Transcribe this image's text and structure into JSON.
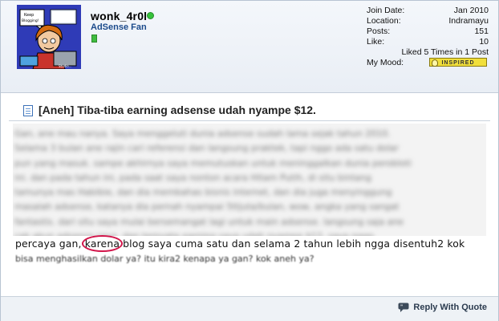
{
  "user": {
    "name": "wonk_4r0l",
    "title": "AdSense Fan",
    "avatar_speech": "Keep Blogging !",
    "avatar_caption": "Studio..."
  },
  "stats": {
    "join_date_label": "Join Date:",
    "join_date": "Jan 2010",
    "location_label": "Location:",
    "location": "Indramayu",
    "posts_label": "Posts:",
    "posts": "151",
    "like_label": "Like:",
    "like": "10",
    "liked_text": "Liked 5 Times in 1 Post",
    "mood_label": "My Mood:",
    "mood": "INSPIRED"
  },
  "post": {
    "title": "[Aneh] Tiba-tiba earning adsense udah nyampe $12.",
    "blurred_lines": [
      "Gan, ane mau nanya. Saya menggeluti dunia adsense sudah lama sejak tahun 2010.",
      "Selama 3 bulan ane rajin cari referensi dan langsung praktek, tapi nggo ada satu dolar",
      "pun yang masuk. sampe akhirnya saya memutuskan untuk meninggalkan dunia perobloti",
      "ini. dan pada tahun ini, pada saat saya nonton acara Hitam Putih, di situ bintang",
      "tamunya mas Habibie, dan dia membahas bisnis internet, dan dia juga menyinggung",
      "masalah adsense, katanya dia pernah nyampai 5ttjuta/bulan, wow, angka yang sangat",
      "fantastis. dari situ saya mulai bersemangat lagi untuk main adsense. langsung saja ane",
      "cek akun adsense saya, dan ternyata earning saya udah nyampe $12, saya nggo"
    ],
    "line_before": "percaya gan,",
    "highlight": "karena",
    "line_after": "blog saya cuma satu dan selama 2 tahun lebih ngga disentuh2 kok",
    "last_line": "bisa menghasilkan dolar ya? itu kira2 kenapa ya gan? kok aneh ya?"
  },
  "footer": {
    "reply_label": "Reply With Quote"
  },
  "colors": {
    "header_bg": "#e9eef5",
    "title_blue": "#1b4a8b",
    "highlight_circle": "#d2154a",
    "mood_badge": "#f1df3b"
  }
}
